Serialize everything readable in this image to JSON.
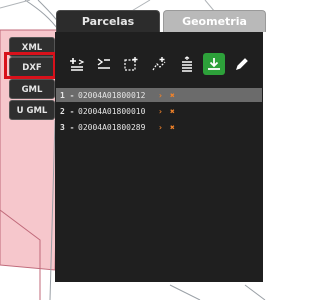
{
  "side_buttons": {
    "xml": "XML",
    "dxf": "DXF",
    "gml": "GML",
    "ugml": "U GML"
  },
  "tabs": {
    "parcelas": "Parcelas",
    "geometria": "Geometria"
  },
  "toolbar": {
    "icons": [
      "add-parcel-icon",
      "edit-list-icon",
      "select-area-icon",
      "add-area-icon",
      "stack-icon",
      "download-icon",
      "pencil-icon"
    ],
    "active_color": "#2da13a"
  },
  "parcels": [
    {
      "num": "1 -",
      "id": "02004A01800012",
      "go": "›",
      "del": "✖",
      "selected": true
    },
    {
      "num": "2 -",
      "id": "02004A01800010",
      "go": "›",
      "del": "✖",
      "selected": false
    },
    {
      "num": "3 -",
      "id": "02004A01800289",
      "go": "›",
      "del": "✖",
      "selected": false
    }
  ],
  "colors": {
    "panel_bg": "#1f1f1f",
    "accent_orange": "#f0822a",
    "highlight_red": "#d8111b",
    "map_parcel_fill": "#f6c7cc",
    "map_parcel_stroke": "#c06a7a"
  }
}
